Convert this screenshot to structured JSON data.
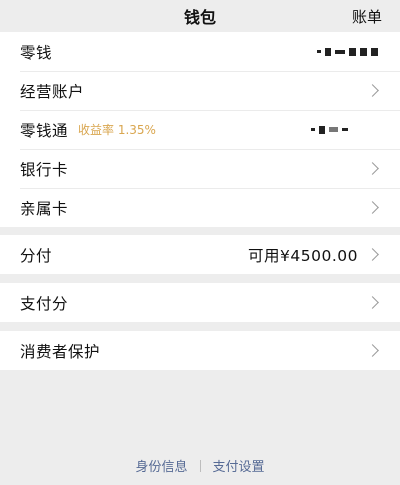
{
  "header": {
    "title": "钱包",
    "right_link": "账单"
  },
  "rows_group1": [
    {
      "label": "零钱",
      "hidden_value": true
    },
    {
      "label": "经营账户"
    },
    {
      "label": "零钱通",
      "sublabel": "收益率 1.35%",
      "hidden_value": true
    },
    {
      "label": "银行卡"
    },
    {
      "label": "亲属卡"
    }
  ],
  "row_fenfu": {
    "label": "分付",
    "value": "可用¥4500.00"
  },
  "row_zhifufen": {
    "label": "支付分"
  },
  "row_protection": {
    "label": "消费者保护"
  },
  "footer": {
    "link1": "身份信息",
    "link2": "支付设置"
  },
  "colors": {
    "accent_gold": "#d9a64f",
    "link_blue": "#576b95"
  }
}
